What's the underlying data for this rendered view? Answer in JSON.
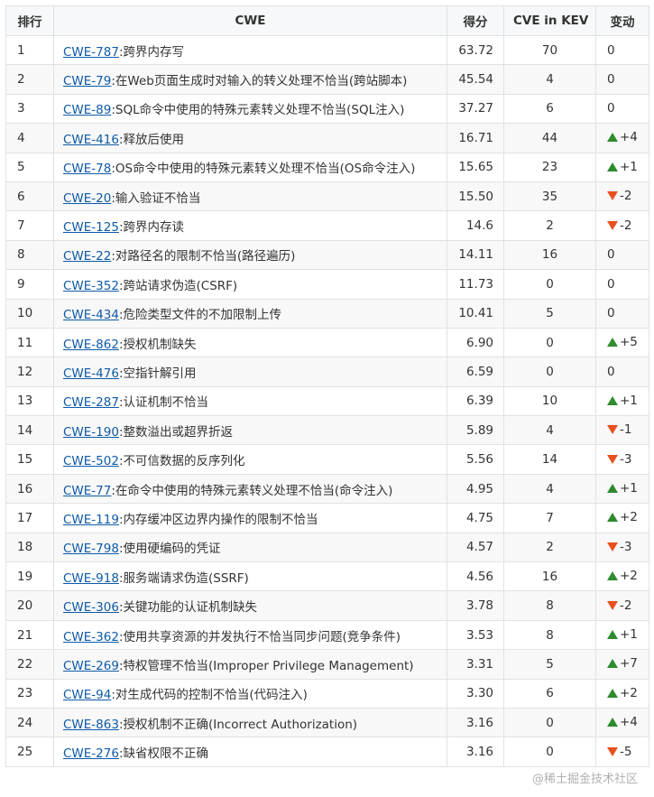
{
  "headers": {
    "rank": "排行",
    "cwe": "CWE",
    "score": "得分",
    "kev": "CVE in KEV",
    "change": "变动"
  },
  "colors": {
    "link": "#0e5aa7",
    "up": "#2e8b2e",
    "down": "#e8501e",
    "header_bg": "#f6f8fa",
    "border": "#dfe2e5"
  },
  "rows": [
    {
      "rank": "1",
      "id": "CWE-787",
      "desc": ":跨界内存写",
      "score": "63.72",
      "kev": "70",
      "dir": "",
      "change": "0"
    },
    {
      "rank": "2",
      "id": "CWE-79",
      "desc": ":在Web页面生成时对输入的转义处理不恰当(跨站脚本)",
      "score": "45.54",
      "kev": "4",
      "dir": "",
      "change": "0"
    },
    {
      "rank": "3",
      "id": "CWE-89",
      "desc": ":SQL命令中使用的特殊元素转义处理不恰当(SQL注入)",
      "score": "37.27",
      "kev": "6",
      "dir": "",
      "change": "0"
    },
    {
      "rank": "4",
      "id": "CWE-416",
      "desc": ":释放后使用",
      "score": "16.71",
      "kev": "44",
      "dir": "up",
      "change": "+4"
    },
    {
      "rank": "5",
      "id": "CWE-78",
      "desc": ":OS命令中使用的特殊元素转义处理不恰当(OS命令注入)",
      "score": "15.65",
      "kev": "23",
      "dir": "up",
      "change": "+1"
    },
    {
      "rank": "6",
      "id": "CWE-20",
      "desc": ":输入验证不恰当",
      "score": "15.50",
      "kev": "35",
      "dir": "down",
      "change": "-2"
    },
    {
      "rank": "7",
      "id": "CWE-125",
      "desc": ":跨界内存读",
      "score": "14.6",
      "kev": "2",
      "dir": "down",
      "change": "-2"
    },
    {
      "rank": "8",
      "id": "CWE-22",
      "desc": ":对路径名的限制不恰当(路径遍历)",
      "score": "14.11",
      "kev": "16",
      "dir": "",
      "change": "0"
    },
    {
      "rank": "9",
      "id": "CWE-352",
      "desc": ":跨站请求伪造(CSRF)",
      "score": "11.73",
      "kev": "0",
      "dir": "",
      "change": "0"
    },
    {
      "rank": "10",
      "id": "CWE-434",
      "desc": ":危险类型文件的不加限制上传",
      "score": "10.41",
      "kev": "5",
      "dir": "",
      "change": "0"
    },
    {
      "rank": "11",
      "id": "CWE-862",
      "desc": ":授权机制缺失",
      "score": "6.90",
      "kev": "0",
      "dir": "up",
      "change": "+5"
    },
    {
      "rank": "12",
      "id": "CWE-476",
      "desc": ":空指针解引用",
      "score": "6.59",
      "kev": "0",
      "dir": "",
      "change": "0"
    },
    {
      "rank": "13",
      "id": "CWE-287",
      "desc": ":认证机制不恰当",
      "score": "6.39",
      "kev": "10",
      "dir": "up",
      "change": "+1"
    },
    {
      "rank": "14",
      "id": "CWE-190",
      "desc": ":整数溢出或超界折返",
      "score": "5.89",
      "kev": "4",
      "dir": "down",
      "change": "-1"
    },
    {
      "rank": "15",
      "id": "CWE-502",
      "desc": ":不可信数据的反序列化",
      "score": "5.56",
      "kev": "14",
      "dir": "down",
      "change": "-3"
    },
    {
      "rank": "16",
      "id": "CWE-77",
      "desc": ":在命令中使用的特殊元素转义处理不恰当(命令注入)",
      "score": "4.95",
      "kev": "4",
      "dir": "up",
      "change": "+1"
    },
    {
      "rank": "17",
      "id": "CWE-119",
      "desc": ":内存缓冲区边界内操作的限制不恰当",
      "score": "4.75",
      "kev": "7",
      "dir": "up",
      "change": "+2"
    },
    {
      "rank": "18",
      "id": "CWE-798",
      "desc": ":使用硬编码的凭证",
      "score": "4.57",
      "kev": "2",
      "dir": "down",
      "change": "-3"
    },
    {
      "rank": "19",
      "id": "CWE-918",
      "desc": ":服务端请求伪造(SSRF)",
      "score": "4.56",
      "kev": "16",
      "dir": "up",
      "change": "+2"
    },
    {
      "rank": "20",
      "id": "CWE-306",
      "desc": ":关键功能的认证机制缺失",
      "score": "3.78",
      "kev": "8",
      "dir": "down",
      "change": "-2"
    },
    {
      "rank": "21",
      "id": "CWE-362",
      "desc": ":使用共享资源的并发执行不恰当同步问题(竞争条件)",
      "score": "3.53",
      "kev": "8",
      "dir": "up",
      "change": "+1"
    },
    {
      "rank": "22",
      "id": "CWE-269",
      "desc": ":特权管理不恰当(Improper Privilege Management)",
      "score": "3.31",
      "kev": "5",
      "dir": "up",
      "change": "+7"
    },
    {
      "rank": "23",
      "id": "CWE-94",
      "desc": ":对生成代码的控制不恰当(代码注入)",
      "score": "3.30",
      "kev": "6",
      "dir": "up",
      "change": "+2"
    },
    {
      "rank": "24",
      "id": "CWE-863",
      "desc": ":授权机制不正确(Incorrect Authorization)",
      "score": "3.16",
      "kev": "0",
      "dir": "up",
      "change": "+4"
    },
    {
      "rank": "25",
      "id": "CWE-276",
      "desc": ":缺省权限不正确",
      "score": "3.16",
      "kev": "0",
      "dir": "down",
      "change": "-5"
    }
  ],
  "watermark": "@稀土掘金技术社区"
}
